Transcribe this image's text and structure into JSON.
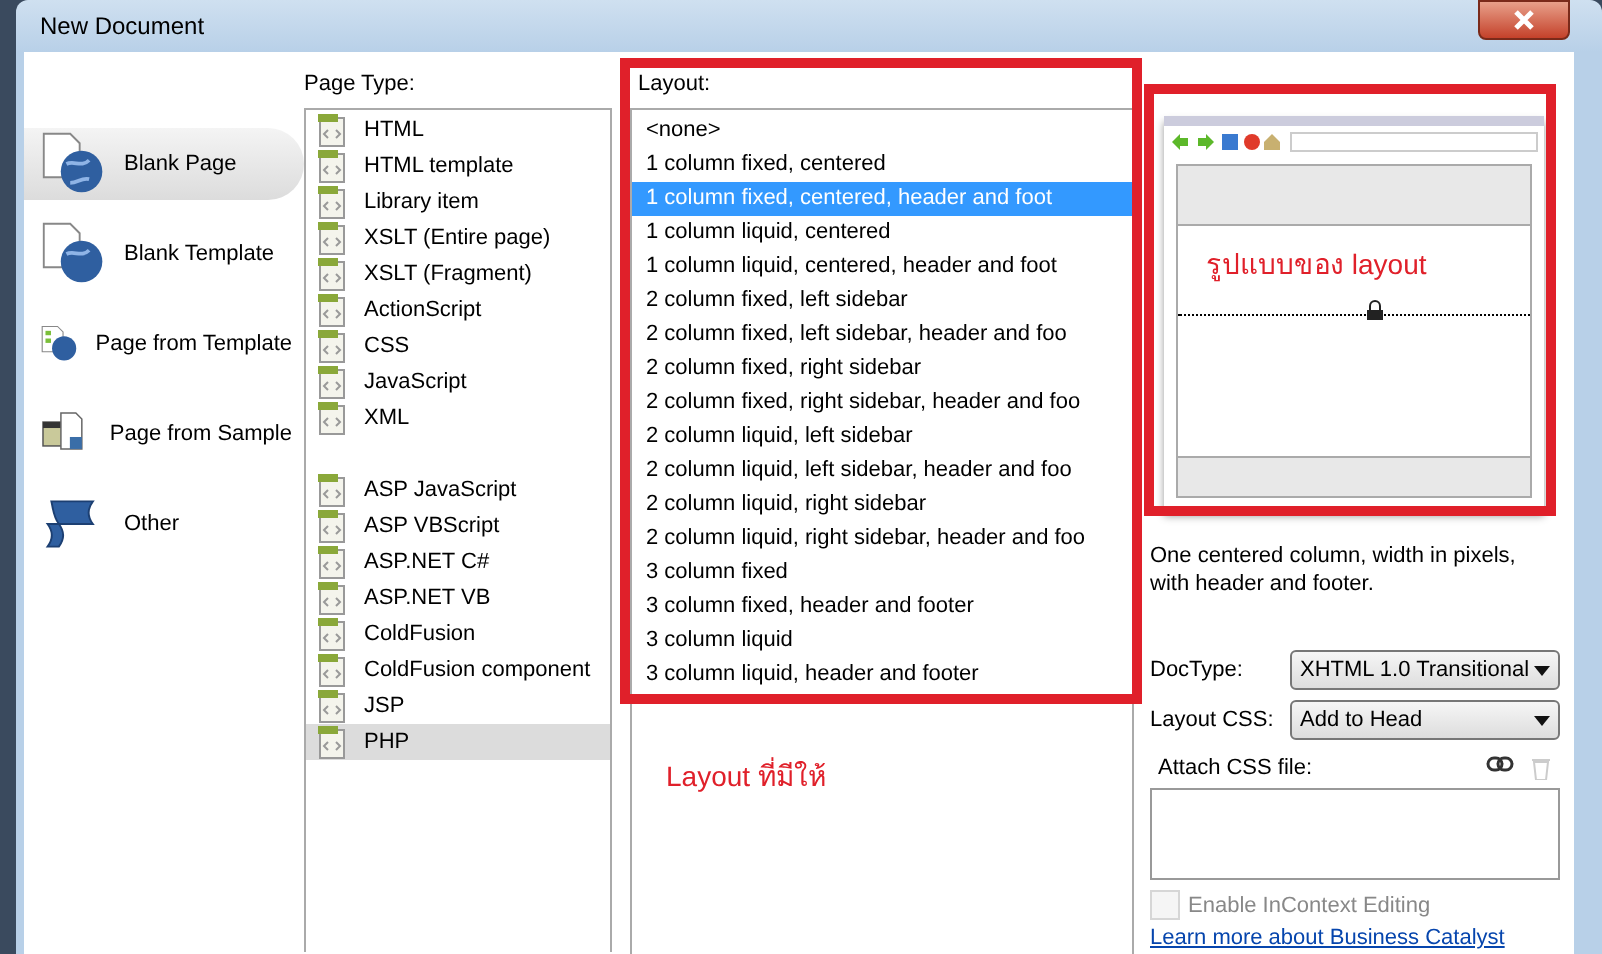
{
  "window": {
    "title": "New Document"
  },
  "categories": [
    {
      "label": "Blank Page",
      "selected": true,
      "kind": "blank"
    },
    {
      "label": "Blank Template",
      "selected": false,
      "kind": "template"
    },
    {
      "label": "Page from Template",
      "selected": false,
      "kind": "from-template"
    },
    {
      "label": "Page from Sample",
      "selected": false,
      "kind": "sample"
    },
    {
      "label": "Other",
      "selected": false,
      "kind": "other"
    }
  ],
  "page_type": {
    "label": "Page Type:",
    "groups": [
      [
        {
          "label": "HTML",
          "selected": false
        },
        {
          "label": "HTML template",
          "selected": false
        },
        {
          "label": "Library item",
          "selected": false
        },
        {
          "label": "XSLT (Entire page)",
          "selected": false
        },
        {
          "label": "XSLT (Fragment)",
          "selected": false
        },
        {
          "label": "ActionScript",
          "selected": false
        },
        {
          "label": "CSS",
          "selected": false
        },
        {
          "label": "JavaScript",
          "selected": false
        },
        {
          "label": "XML",
          "selected": false
        }
      ],
      [
        {
          "label": "ASP JavaScript",
          "selected": false
        },
        {
          "label": "ASP VBScript",
          "selected": false
        },
        {
          "label": "ASP.NET C#",
          "selected": false
        },
        {
          "label": "ASP.NET VB",
          "selected": false
        },
        {
          "label": "ColdFusion",
          "selected": false
        },
        {
          "label": "ColdFusion component",
          "selected": false
        },
        {
          "label": "JSP",
          "selected": false
        },
        {
          "label": "PHP",
          "selected": true
        }
      ]
    ]
  },
  "layout": {
    "label": "Layout:",
    "items": [
      {
        "label": "<none>",
        "selected": false
      },
      {
        "label": "1 column fixed, centered",
        "selected": false
      },
      {
        "label": "1 column fixed, centered, header and foot",
        "selected": true
      },
      {
        "label": "1 column liquid, centered",
        "selected": false
      },
      {
        "label": "1 column liquid, centered, header and foot",
        "selected": false
      },
      {
        "label": "2 column fixed, left sidebar",
        "selected": false
      },
      {
        "label": "2 column fixed, left sidebar, header and foo",
        "selected": false
      },
      {
        "label": "2 column fixed, right sidebar",
        "selected": false
      },
      {
        "label": "2 column fixed, right sidebar, header and foo",
        "selected": false
      },
      {
        "label": "2 column liquid, left sidebar",
        "selected": false
      },
      {
        "label": "2 column liquid, left sidebar, header and foo",
        "selected": false
      },
      {
        "label": "2 column liquid, right sidebar",
        "selected": false
      },
      {
        "label": "2 column liquid, right sidebar, header and foo",
        "selected": false
      },
      {
        "label": "3 column fixed",
        "selected": false
      },
      {
        "label": "3 column fixed, header and footer",
        "selected": false
      },
      {
        "label": "3 column liquid",
        "selected": false
      },
      {
        "label": "3 column liquid, header and footer",
        "selected": false
      }
    ]
  },
  "annotations": {
    "layout_note": "Layout ที่มีให้",
    "preview_note": "รูปแบบของ  layout"
  },
  "preview": {
    "description": "One centered column, width in pixels, with header and footer."
  },
  "doctype": {
    "label": "DocType:",
    "value": "XHTML 1.0 Transitional"
  },
  "layout_css": {
    "label": "Layout CSS:",
    "value": "Add to Head"
  },
  "attach_css": {
    "label": "Attach CSS file:"
  },
  "incontext": {
    "label": "Enable InContext Editing",
    "checked": false,
    "disabled": true
  },
  "link": "Learn more about Business Catalyst"
}
